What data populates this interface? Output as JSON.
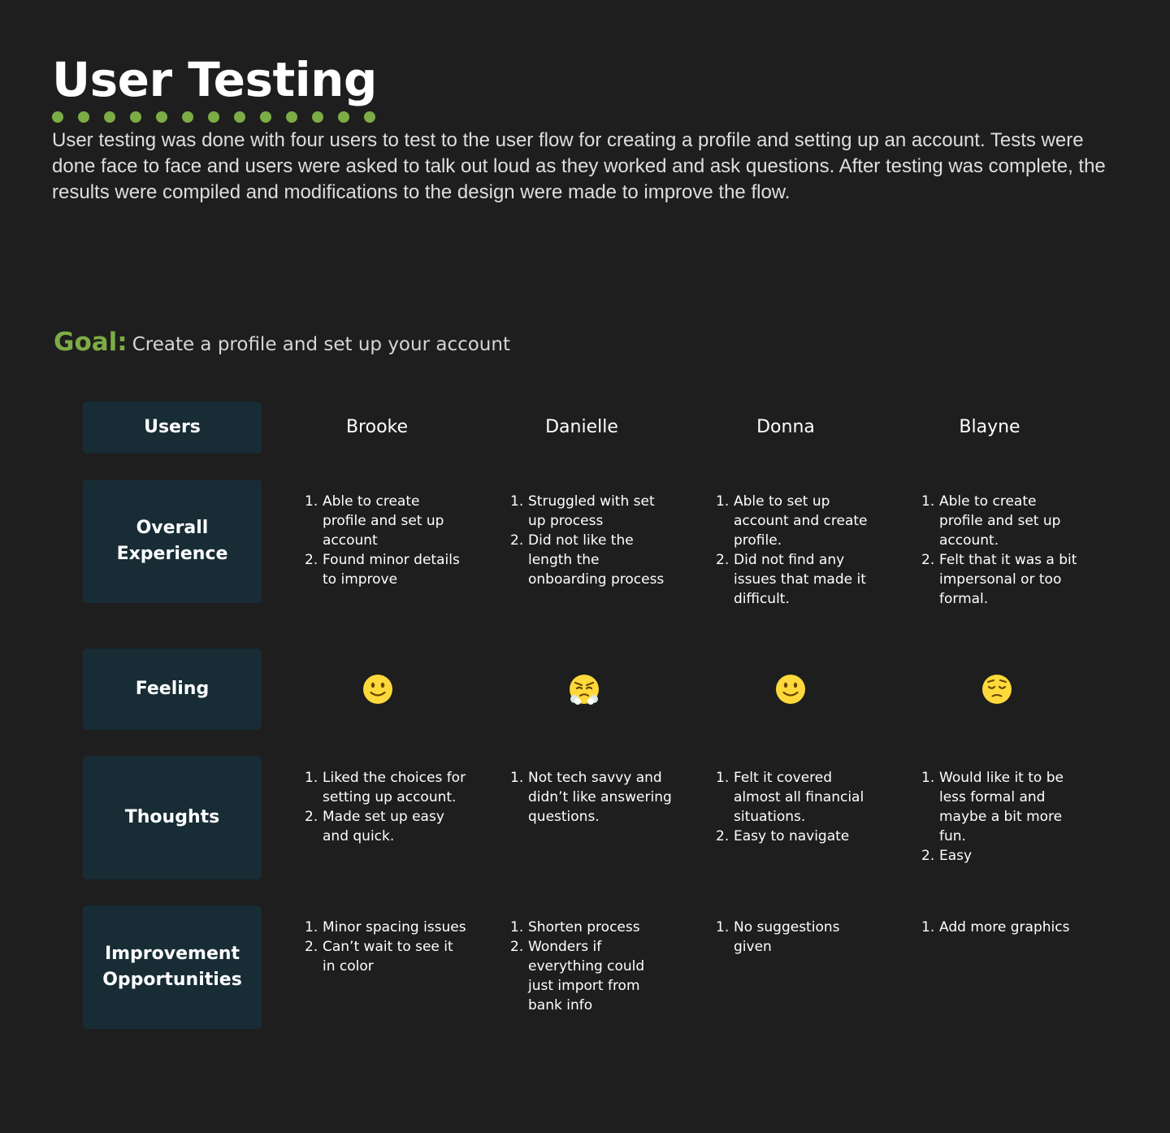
{
  "page": {
    "title": "User Testing",
    "intro": "User testing was done with four users to test to the user flow for creating a profile and setting up an account.  Tests were done face to face and users were asked to talk out loud as they worked and ask questions.   After testing was complete, the results were compiled and modifications to the design were made to improve the flow.",
    "dot_count": 13
  },
  "colors": {
    "background": "#1e1e1e",
    "accent_green": "#7cac46",
    "label_box": "#172c35",
    "emoji_yellow": "#ffd93b",
    "emoji_dark": "#664500"
  },
  "goal": {
    "label": "Goal:",
    "text": "Create a profile and set up your account"
  },
  "row_labels": {
    "users": "Users",
    "overall": [
      "Overall",
      "Experience"
    ],
    "feeling": "Feeling",
    "thoughts": "Thoughts",
    "improvement": [
      "Improvement",
      "Opportunities"
    ]
  },
  "users": [
    {
      "name": "Brooke",
      "overall": [
        "Able to create profile and set up account",
        "Found minor details to improve"
      ],
      "feeling_icon": "slightly-smiling-face-icon",
      "thoughts": [
        "Liked the choices for setting up account.",
        "Made set up easy and quick."
      ],
      "improvement": [
        "Minor spacing issues",
        "Can’t wait to see it in color"
      ]
    },
    {
      "name": "Danielle",
      "overall": [
        "Struggled with set up process",
        "Did not like the length  the onboarding process"
      ],
      "feeling_icon": "face-with-steam-from-nose-icon",
      "thoughts": [
        "Not tech savvy and didn’t like answering questions."
      ],
      "improvement": [
        "Shorten process",
        "Wonders if everything could just import from bank info"
      ]
    },
    {
      "name": "Donna",
      "overall": [
        "Able to set up account and create profile.",
        " Did not find any issues that made it difficult."
      ],
      "feeling_icon": "slightly-smiling-face-icon",
      "thoughts": [
        "Felt it covered almost all financial situations.",
        "Easy to navigate"
      ],
      "improvement": [
        "No suggestions given"
      ]
    },
    {
      "name": "Blayne",
      "overall": [
        "Able to create profile and set up account.",
        "Felt that it was a bit impersonal or too formal."
      ],
      "feeling_icon": "pensive-face-icon",
      "thoughts": [
        "Would like it to be less formal and maybe a bit more fun.",
        "Easy"
      ],
      "improvement": [
        "Add more graphics"
      ]
    }
  ]
}
